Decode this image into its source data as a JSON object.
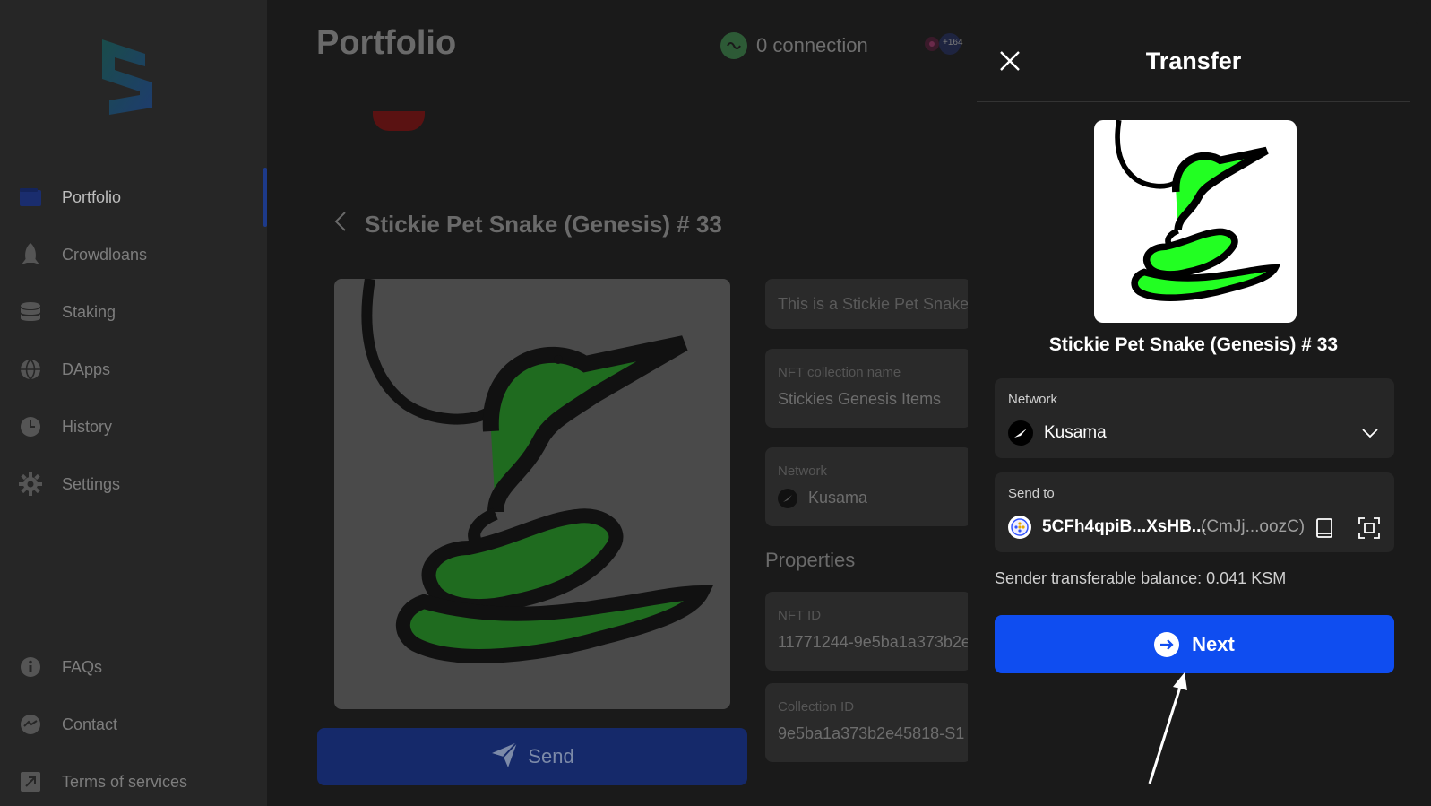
{
  "sidebar": {
    "items": [
      {
        "label": "Portfolio",
        "icon": "wallet-icon"
      },
      {
        "label": "Crowdloans",
        "icon": "rocket-icon"
      },
      {
        "label": "Staking",
        "icon": "database-icon"
      },
      {
        "label": "DApps",
        "icon": "globe-icon"
      },
      {
        "label": "History",
        "icon": "clock-icon"
      },
      {
        "label": "Settings",
        "icon": "gear-icon"
      }
    ],
    "bottom_items": [
      {
        "label": "FAQs",
        "icon": "info-icon"
      },
      {
        "label": "Contact",
        "icon": "chat-icon"
      },
      {
        "label": "Terms of services",
        "icon": "external-link-icon"
      }
    ]
  },
  "header": {
    "title": "Portfolio",
    "connection": "0 connection",
    "account_badge": "+164"
  },
  "detail": {
    "nft_name": "Stickie Pet Snake (Genesis) # 33",
    "send_label": "Send",
    "description": "This is a Stickie Pet Snake",
    "collection_label": "NFT collection name",
    "collection_value": "Stickies Genesis Items",
    "network_label": "Network",
    "network_value": "Kusama",
    "properties_title": "Properties",
    "nft_id_label": "NFT ID",
    "nft_id_value": "11771244-9e5ba1a373b2e",
    "collection_id_label": "Collection ID",
    "collection_id_value": "9e5ba1a373b2e45818-S1"
  },
  "modal": {
    "title": "Transfer",
    "nft_name": "Stickie Pet Snake (Genesis) # 33",
    "network_label": "Network",
    "network_value": "Kusama",
    "send_to_label": "Send to",
    "address": "5CFh4qpiB...XsHB...",
    "address_alias": "(CmJj...oozC)",
    "balance_text": "Sender transferable balance: 0.041 KSM",
    "next_label": "Next"
  },
  "colors": {
    "accent": "#0f4df0",
    "snake_green": "#22ff22",
    "background": "#1a1a1a"
  }
}
